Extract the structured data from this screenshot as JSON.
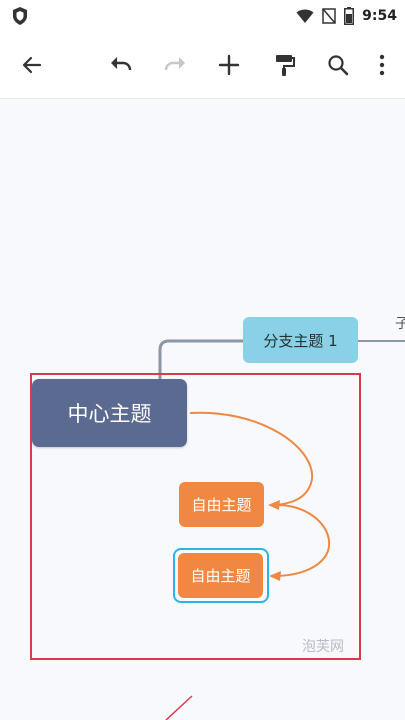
{
  "status_bar": {
    "time": "9:54",
    "icons": [
      "shield-icon",
      "wifi-icon",
      "signal-off-icon",
      "battery-icon"
    ]
  },
  "toolbar": {
    "buttons": [
      {
        "name": "back-icon"
      },
      {
        "name": "undo-icon"
      },
      {
        "name": "redo-icon",
        "disabled": true
      },
      {
        "name": "add-icon"
      },
      {
        "name": "format-paint-icon"
      },
      {
        "name": "search-icon"
      },
      {
        "name": "more-vert-icon"
      }
    ]
  },
  "mindmap": {
    "center_topic": "中心主题",
    "branch_topic": "分支主题 1",
    "free_topics": [
      "自由主题",
      "自由主题"
    ],
    "cut_off_subtopic": "子",
    "colors": {
      "center": "#5b6a91",
      "branch": "#8ad0e6",
      "free": "#f08843",
      "connector": "#f08843",
      "branch_line": "#8c96a6",
      "selection_outline": "#29b6e6",
      "highlight_box": "#d83a4a"
    }
  },
  "watermark": "泡芙网"
}
